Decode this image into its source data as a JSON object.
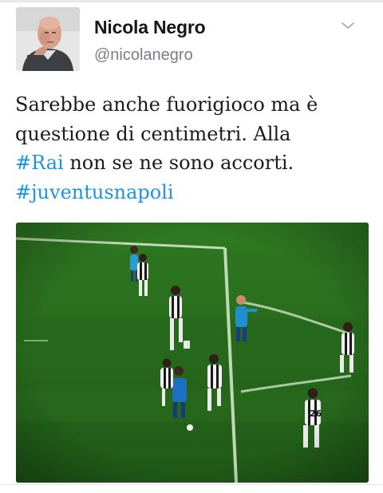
{
  "tweet": {
    "author": {
      "display_name": "Nicola Negro",
      "handle": "@nicolanegro",
      "avatar_icon": "profile-photo"
    },
    "menu_icon": "chevron-down-icon",
    "text": {
      "line1": "Sarebbe anche fuorigioco ma è",
      "line2": "questione di centimetri. Alla",
      "line3_hashtag": "#Rai",
      "line3_rest": " non se ne sono accorti.",
      "line4_hashtag": "#juventusnapoli"
    },
    "media": {
      "jersey_number": "26"
    }
  },
  "colors": {
    "hashtag": "#1c94e0",
    "name": "#14171a",
    "handle": "#777f86",
    "pitch": "#2a6e1e"
  }
}
